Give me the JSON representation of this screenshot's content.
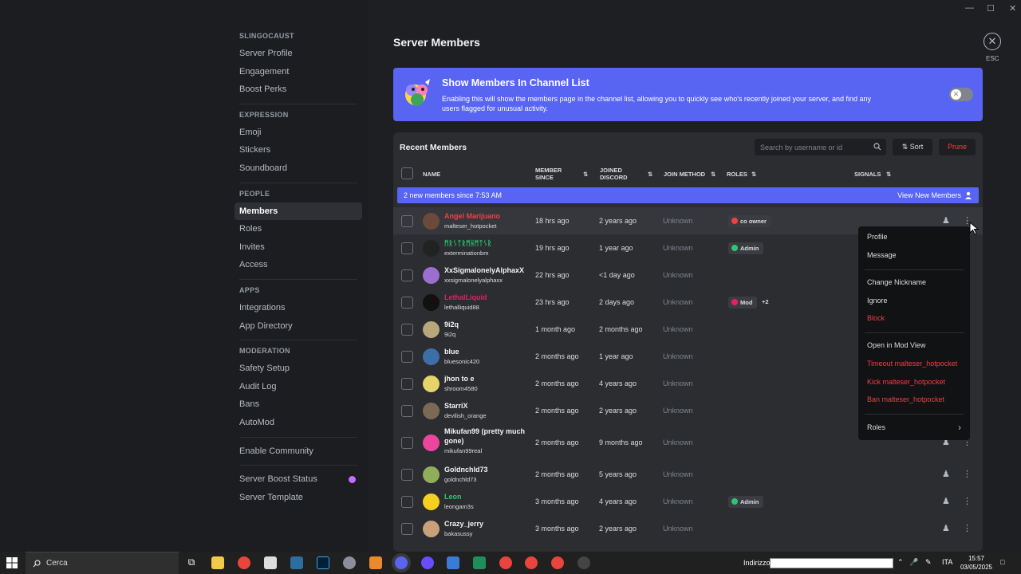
{
  "sidebar": {
    "sections": [
      {
        "category": "SLINGOCAUST",
        "items": [
          "Server Profile",
          "Engagement",
          "Boost Perks"
        ]
      },
      {
        "category": "EXPRESSION",
        "items": [
          "Emoji",
          "Stickers",
          "Soundboard"
        ]
      },
      {
        "category": "PEOPLE",
        "items": [
          "Members",
          "Roles",
          "Invites",
          "Access"
        ]
      },
      {
        "category": "APPS",
        "items": [
          "Integrations",
          "App Directory"
        ]
      },
      {
        "category": "MODERATION",
        "items": [
          "Safety Setup",
          "Audit Log",
          "Bans",
          "AutoMod"
        ]
      }
    ],
    "extra": [
      "Enable Community",
      "Server Boost Status",
      "Server Template"
    ],
    "active": "Members"
  },
  "page": {
    "title": "Server Members",
    "esc": "ESC"
  },
  "banner": {
    "title": "Show Members In Channel List",
    "description": "Enabling this will show the members page in the channel list, allowing you to quickly see who's recently joined your server, and find any users flagged for unusual activity.",
    "toggle_on": false
  },
  "panel": {
    "title": "Recent Members",
    "search_placeholder": "Search by username or id",
    "sort_label": "Sort",
    "prune_label": "Prune",
    "columns": {
      "name": "NAME",
      "member_since_1": "MEMBER",
      "member_since_2": "SINCE",
      "joined_1": "JOINED",
      "joined_2": "DISCORD",
      "join_method": "JOIN METHOD",
      "roles": "ROLES",
      "signals": "SIGNALS"
    },
    "new_bar": {
      "text": "2 new members since 7:53 AM",
      "link": "View New Members"
    }
  },
  "members": [
    {
      "name": "Angel Marijuano",
      "handle": "malteser_hotpocket",
      "since": "18 hrs ago",
      "joined": "2 years ago",
      "method": "Unknown",
      "name_color": "#f23f43",
      "role": "co owner",
      "role_color": "#f23f43",
      "more": "",
      "avatar": "#6b4a3a"
    },
    {
      "name": "ᛗᚱᛊᛏᚱᛗᚺᛗᛏᛊᚱ",
      "handle": "exterminationbm",
      "since": "19 hrs ago",
      "joined": "1 year ago",
      "method": "Unknown",
      "name_color": "#2dc770",
      "role": "Admin",
      "role_color": "#2dc770",
      "more": "",
      "avatar": "#222"
    },
    {
      "name": "XxSigmalonelyAlphaxX",
      "handle": "xxsigmalonelyalphaxx",
      "since": "22 hrs ago",
      "joined": "<1 day ago",
      "method": "Unknown",
      "name_color": "#f2f3f5",
      "role": "",
      "role_color": "",
      "more": "",
      "avatar": "#9b6fd0"
    },
    {
      "name": "LethalLiquid",
      "handle": "lethalliquid88",
      "since": "23 hrs ago",
      "joined": "2 days ago",
      "method": "Unknown",
      "name_color": "#e91e63",
      "role": "Mod",
      "role_color": "#e91e63",
      "more": "+2",
      "avatar": "#111"
    },
    {
      "name": "9i2q",
      "handle": "9i2q",
      "since": "1 month ago",
      "joined": "2 months ago",
      "method": "Unknown",
      "name_color": "#f2f3f5",
      "role": "",
      "role_color": "",
      "more": "",
      "avatar": "#b8a77a"
    },
    {
      "name": "blue",
      "handle": "bluesonic420",
      "since": "2 months ago",
      "joined": "1 year ago",
      "method": "Unknown",
      "name_color": "#f2f3f5",
      "role": "",
      "role_color": "",
      "more": "",
      "avatar": "#3d6ea8"
    },
    {
      "name": "jhon to e",
      "handle": "shroom4580",
      "since": "2 months ago",
      "joined": "4 years ago",
      "method": "Unknown",
      "name_color": "#f2f3f5",
      "role": "",
      "role_color": "",
      "more": "",
      "avatar": "#e6d36a"
    },
    {
      "name": "StarriX",
      "handle": "devilish_orange",
      "since": "2 months ago",
      "joined": "2 years ago",
      "method": "Unknown",
      "name_color": "#f2f3f5",
      "role": "",
      "role_color": "",
      "more": "",
      "avatar": "#7a6a55"
    },
    {
      "name": "Mikufan99 (pretty much gone)",
      "handle": "mikufan99real",
      "since": "2 months ago",
      "joined": "9 months ago",
      "method": "Unknown",
      "name_color": "#f2f3f5",
      "role": "",
      "role_color": "",
      "more": "",
      "avatar": "#eb459e"
    },
    {
      "name": "Goldnchld73",
      "handle": "goldnchld73",
      "since": "2 months ago",
      "joined": "5 years ago",
      "method": "Unknown",
      "name_color": "#f2f3f5",
      "role": "",
      "role_color": "",
      "more": "",
      "avatar": "#8fae5a"
    },
    {
      "name": "Leon",
      "handle": "leongam3s",
      "since": "3 months ago",
      "joined": "4 years ago",
      "method": "Unknown",
      "name_color": "#2dc770",
      "role": "Admin",
      "role_color": "#2dc770",
      "more": "",
      "avatar": "#f5d020"
    },
    {
      "name": "Crazy_jerry",
      "handle": "bakasussy",
      "since": "3 months ago",
      "joined": "2 years ago",
      "method": "Unknown",
      "name_color": "#f2f3f5",
      "role": "",
      "role_color": "",
      "more": "",
      "avatar": "#c9a07a"
    }
  ],
  "context_menu": {
    "groups": [
      [
        {
          "label": "Profile",
          "danger": false
        },
        {
          "label": "Message",
          "danger": false
        }
      ],
      [
        {
          "label": "Change Nickname",
          "danger": false
        },
        {
          "label": "Ignore",
          "danger": false
        },
        {
          "label": "Block",
          "danger": true
        }
      ],
      [
        {
          "label": "Open in Mod View",
          "danger": false
        },
        {
          "label": "Timeout malteser_hotpocket",
          "danger": true
        },
        {
          "label": "Kick malteser_hotpocket",
          "danger": true
        },
        {
          "label": "Ban malteser_hotpocket",
          "danger": true
        }
      ],
      [
        {
          "label": "Roles",
          "danger": false
        }
      ]
    ]
  },
  "taskbar": {
    "search": "Cerca",
    "address_label": "Indirizzo",
    "lang": "ITA",
    "time": "15:57",
    "date": "03/05/2025"
  },
  "colors": {
    "accent": "#5865f2",
    "danger": "#f23f43",
    "bg": "#1e1f22",
    "panel": "#2b2d31"
  }
}
